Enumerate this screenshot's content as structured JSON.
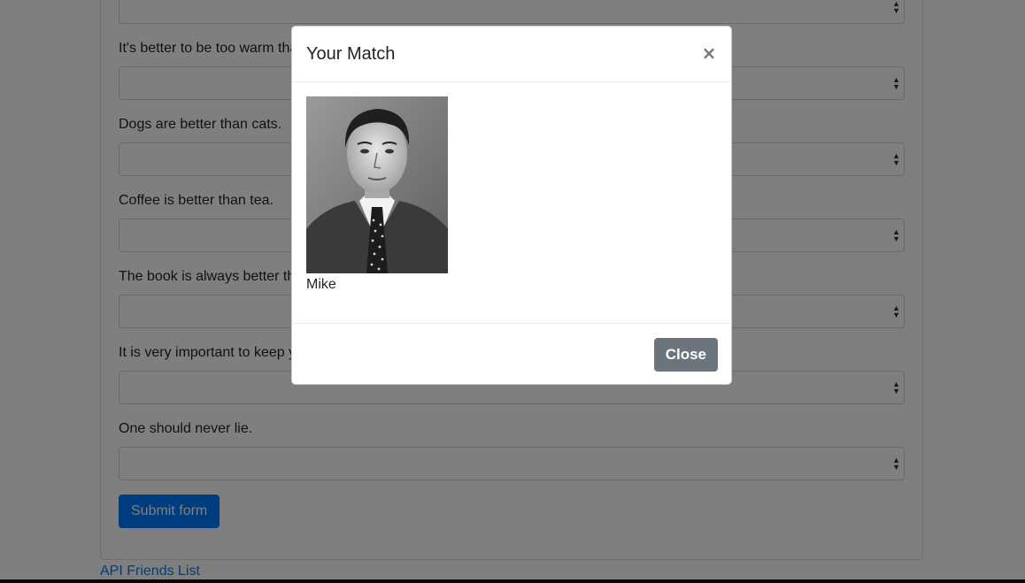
{
  "form": {
    "questions": [
      "It's better to be too warm than too cold.",
      "Dogs are better than cats.",
      "Coffee is better than tea.",
      "The book is always better than the movie.",
      "It is very important to keep your promises.",
      "One should never lie."
    ],
    "submit_label": "Submit form",
    "select_caret": "▲▼"
  },
  "footer": {
    "link_label": "API Friends List"
  },
  "modal": {
    "title": "Your Match",
    "close_x": "×",
    "match_name": "Mike",
    "close_label": "Close"
  },
  "colors": {
    "primary": "#007bff",
    "secondary": "#6c757d",
    "backdrop": "rgba(0,0,0,0.5)"
  }
}
